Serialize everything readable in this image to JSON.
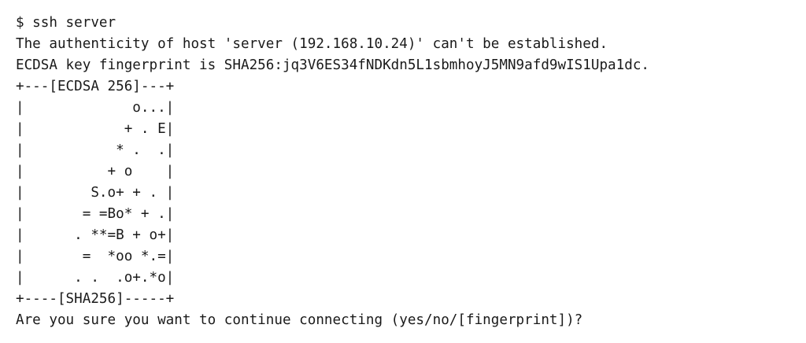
{
  "terminal": {
    "lines": [
      "$ ssh server",
      "The authenticity of host 'server (192.168.10.24)' can't be established.",
      "ECDSA key fingerprint is SHA256:jq3V6ES34fNDKdn5L1sbmhoyJ5MN9afd9wIS1Upa1dc.",
      "+---[ECDSA 256]---+",
      "|             o...|",
      "|            + . E|",
      "|           * .  .|",
      "|          + o    |",
      "|        S.o+ + . |",
      "|       = =Bo* + .|",
      "|      . **=B + o+|",
      "|       =  *oo *.=|",
      "|      . .  .o+.*o|",
      "+----[SHA256]-----+",
      "Are you sure you want to continue connecting (yes/no/[fingerprint])?"
    ]
  }
}
